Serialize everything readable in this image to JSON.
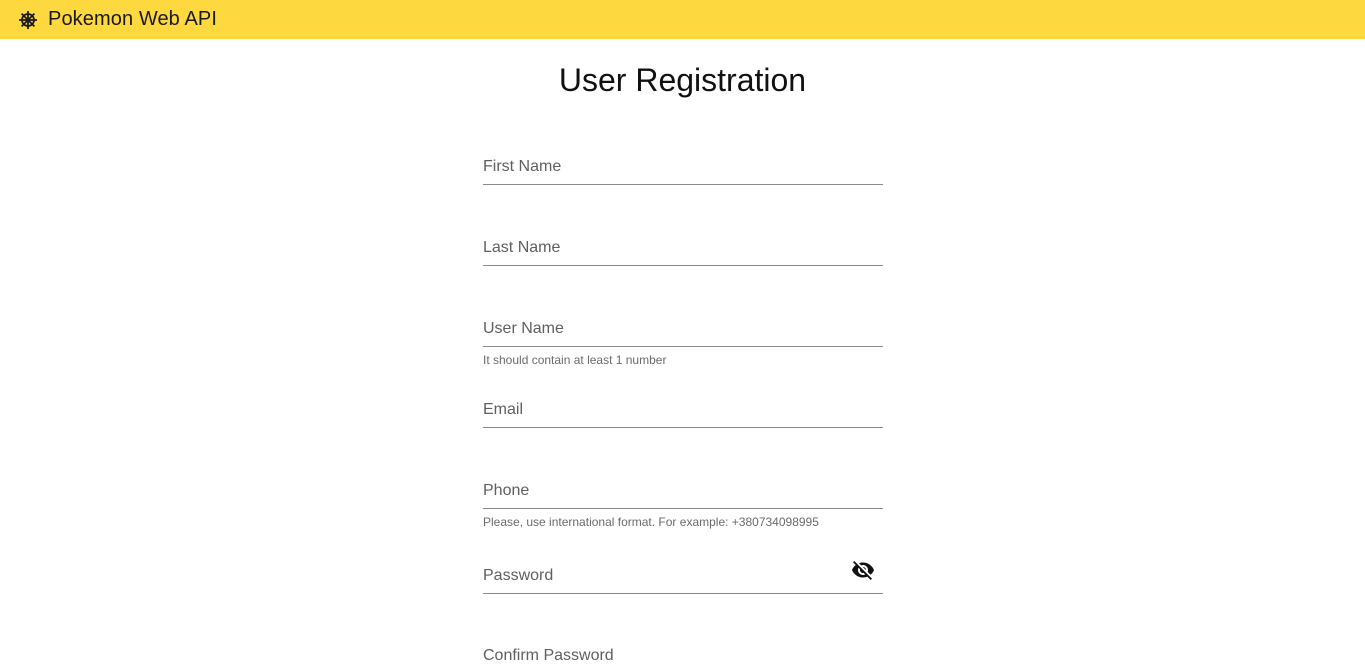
{
  "app": {
    "title": "Pokemon Web API",
    "logo_icon": "pokeball-wheel-icon",
    "header_color": "#fed83f"
  },
  "page": {
    "title": "User Registration"
  },
  "form": {
    "first_name": {
      "label": "First Name",
      "value": ""
    },
    "last_name": {
      "label": "Last Name",
      "value": ""
    },
    "user_name": {
      "label": "User Name",
      "value": "",
      "hint": "It should contain at least 1 number"
    },
    "email": {
      "label": "Email",
      "value": ""
    },
    "phone": {
      "label": "Phone",
      "value": "",
      "hint": "Please, use international format. For example: +380734098995"
    },
    "password": {
      "label": "Password",
      "value": "",
      "toggle_icon": "eye-off-icon"
    },
    "confirm_password": {
      "label": "Confirm Password",
      "value": ""
    }
  }
}
